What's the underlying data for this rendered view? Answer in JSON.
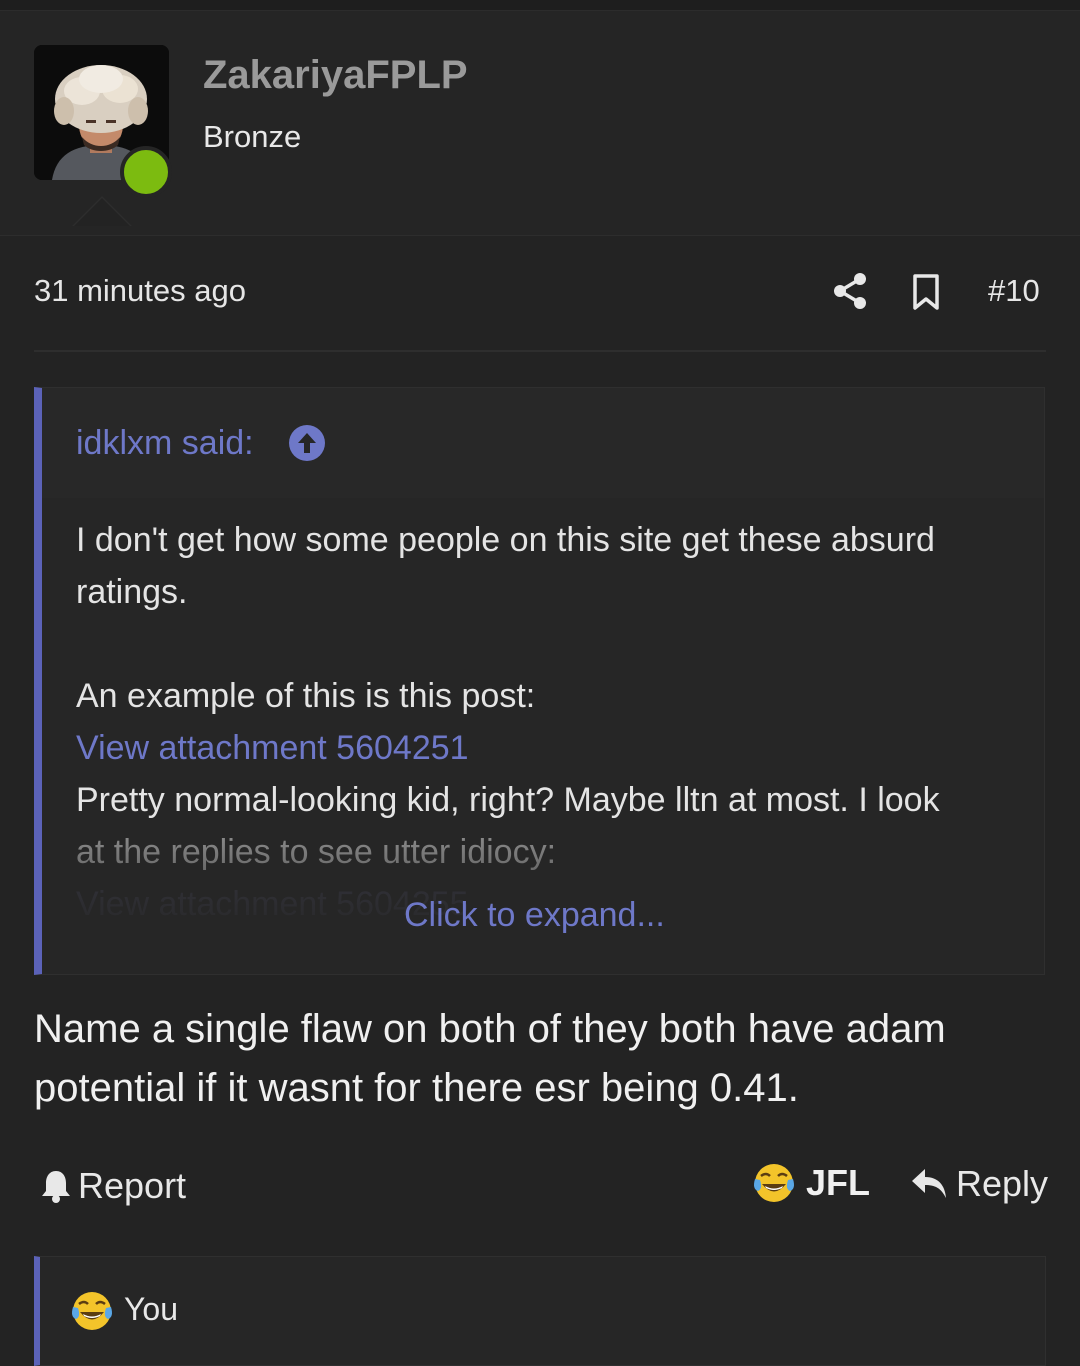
{
  "user": {
    "username": "ZakariyaFPLP",
    "title": "Bronze",
    "online": true,
    "online_color": "#7cbb10",
    "avatar_icon": "avatar-photo"
  },
  "meta": {
    "time": "31 minutes ago",
    "post_number": "#10",
    "share_icon": "share-icon",
    "bookmark_icon": "bookmark-icon"
  },
  "quote": {
    "author_line": "idklxm said:",
    "line1": "I don't get how some people on this site get these absurd ratings.",
    "line2": "An example of this is this post:",
    "attachment1": "View attachment 5604251",
    "line3a": "Pretty normal-looking kid, right? Maybe lltn at most. I look",
    "line3b": "at the replies to see utter idiocy:",
    "attachment2": "View attachment 5604255",
    "expand": "Click to expand...",
    "accent_color": "#5b62b8",
    "link_color": "#6e78c8"
  },
  "post": {
    "text": "Name a single flaw on both of they both have adam potential if it wasnt for there esr being 0.41."
  },
  "actions": {
    "report": "Report",
    "reaction": "JFL",
    "reply": "Reply"
  },
  "reactions": {
    "label": "You"
  }
}
